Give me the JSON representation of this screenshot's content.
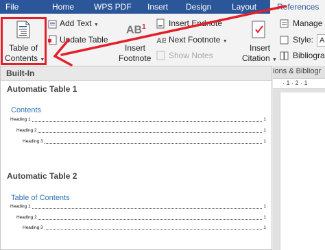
{
  "tabs": [
    {
      "label": "File",
      "active": false
    },
    {
      "label": "Home",
      "active": false
    },
    {
      "label": "WPS PDF",
      "active": false
    },
    {
      "label": "Insert",
      "active": false
    },
    {
      "label": "Design",
      "active": false
    },
    {
      "label": "Layout",
      "active": false
    },
    {
      "label": "References",
      "active": true
    }
  ],
  "ribbon": {
    "toc_line1": "Table of",
    "toc_line2": "Contents",
    "add_text": "Add Text",
    "update_table": "Update Table",
    "insert_footnote_line1": "Insert",
    "insert_footnote_line2": "Footnote",
    "footnote_icon_text": "AB",
    "footnote_icon_sup": "1",
    "insert_endnote": "Insert Endnote",
    "next_footnote": "Next Footnote",
    "show_notes": "Show Notes",
    "insert_citation_line1": "Insert",
    "insert_citation_line2": "Citation",
    "manage": "Manage",
    "style_label": "Style:",
    "style_value": "AP",
    "bibliography": "Bibliogra"
  },
  "group_hint": "ions & Bibliogr",
  "ruler_marks": "· 1 · 2 · 1",
  "dropdown": {
    "section": "Built-In",
    "options": [
      {
        "title": "Automatic Table 1",
        "heading": "Contents",
        "entries": [
          {
            "label": "Heading 1",
            "page": "1"
          },
          {
            "label": "Heading 2",
            "page": "1"
          },
          {
            "label": "Heading 3",
            "page": "1"
          }
        ]
      },
      {
        "title": "Automatic Table 2",
        "heading": "Table of Contents",
        "entries": [
          {
            "label": "Heading 1",
            "page": "1"
          },
          {
            "label": "Heading 2",
            "page": "1"
          },
          {
            "label": "Heading 3",
            "page": "1"
          }
        ]
      }
    ]
  },
  "colors": {
    "tabbar": "#2b579a",
    "annotation_red": "#e3202a",
    "toc_heading_blue": "#2e74b5"
  }
}
